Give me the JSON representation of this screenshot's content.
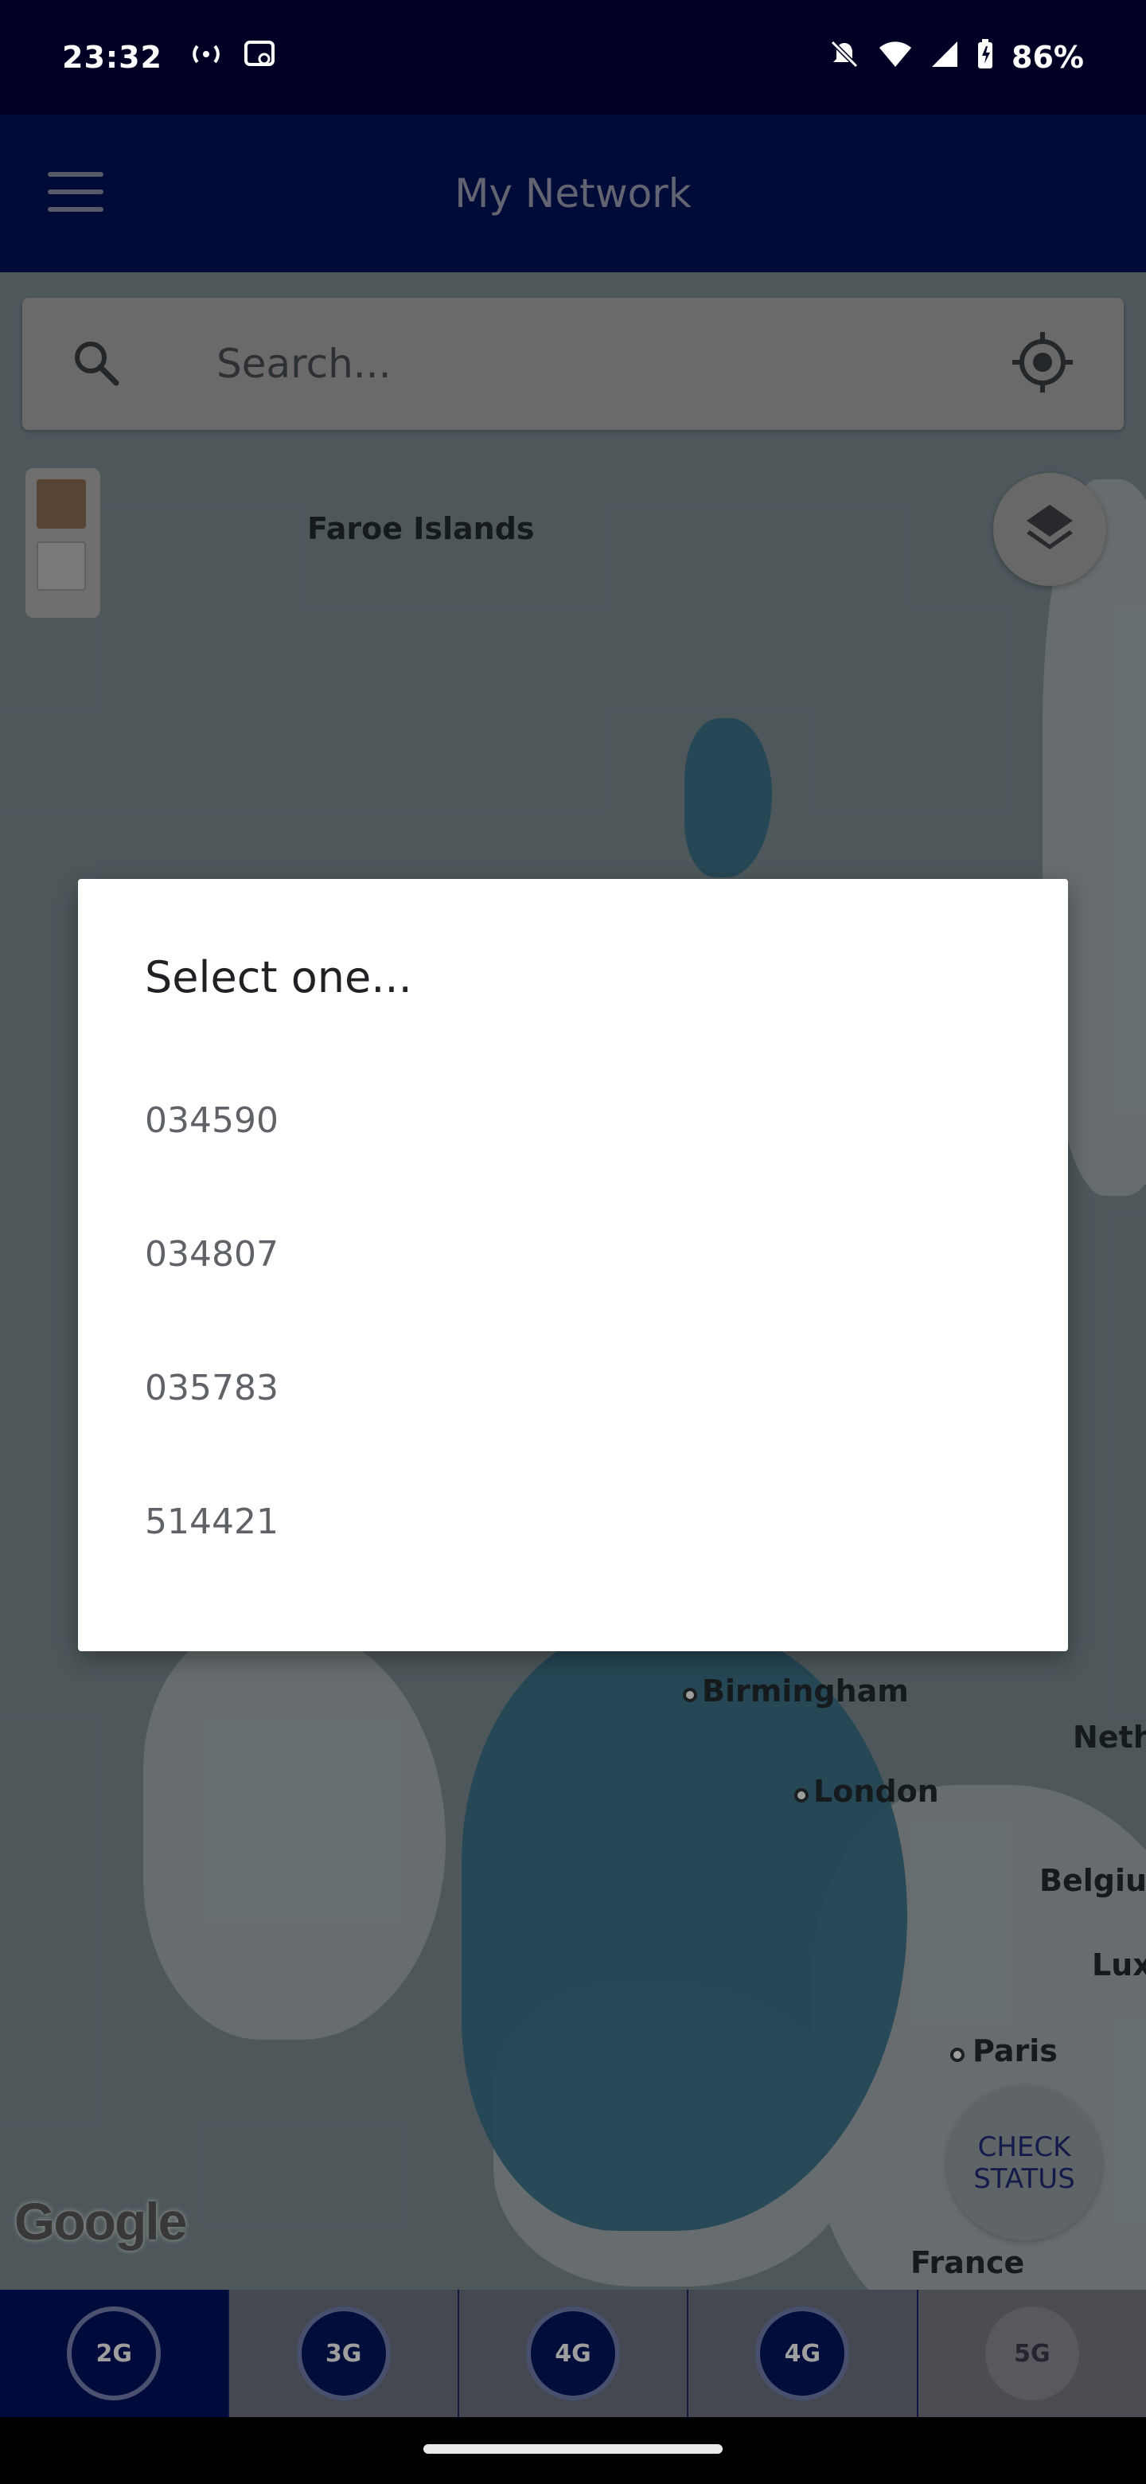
{
  "status_bar": {
    "time": "23:32",
    "battery": "86%"
  },
  "app_bar": {
    "title": "My Network"
  },
  "search": {
    "placeholder": "Search..."
  },
  "map": {
    "places": [
      "Faroe Islands",
      "Birmingham",
      "London",
      "Paris",
      "France",
      "Neth",
      "Belgiu",
      "Lux"
    ],
    "attribution": "Google"
  },
  "check_status": {
    "line1": "CHECK",
    "line2": "STATUS"
  },
  "tabs": [
    {
      "label": "2G",
      "active": true
    },
    {
      "label": "3G",
      "active": false
    },
    {
      "label": "4G",
      "active": false
    },
    {
      "label": "4G",
      "active": false
    },
    {
      "label": "5G",
      "active": false
    }
  ],
  "dialog": {
    "title": "Select one...",
    "options": [
      "034590",
      "034807",
      "035783",
      "514421"
    ]
  },
  "colors": {
    "status_bar": "#000024",
    "app_bar": "#02135a",
    "active_tab": "#021360",
    "dialog_bg": "#ffffff"
  }
}
